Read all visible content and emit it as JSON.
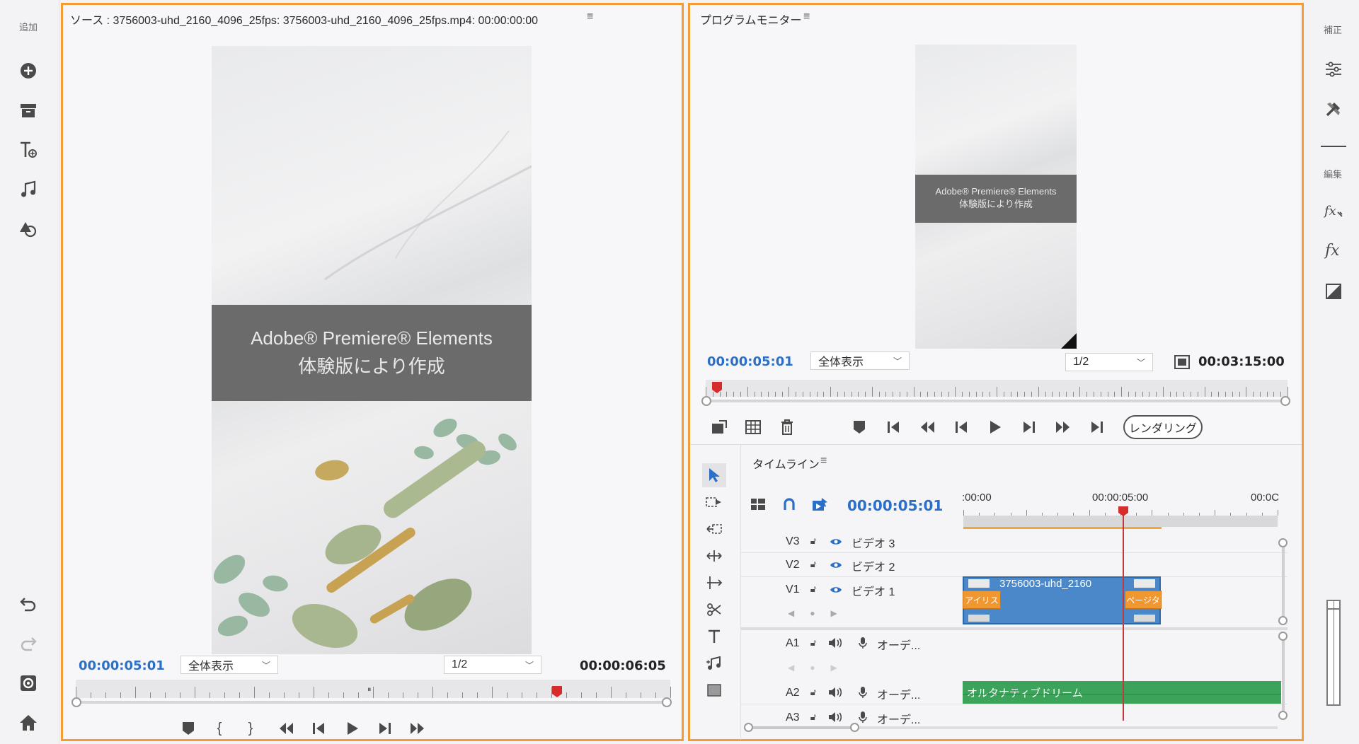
{
  "left_toolbar": {
    "label": "追加",
    "tools": [
      {
        "name": "add-media-icon"
      },
      {
        "name": "project-assets-icon"
      },
      {
        "name": "titles-icon"
      },
      {
        "name": "audio-icon"
      },
      {
        "name": "graphics-icon"
      }
    ],
    "bottom_tools": [
      {
        "name": "undo-icon"
      },
      {
        "name": "redo-icon"
      },
      {
        "name": "organizer-icon"
      },
      {
        "name": "home-icon"
      }
    ]
  },
  "right_toolbar": {
    "label_adjust": "補正",
    "label_edit": "編集"
  },
  "source": {
    "title": "ソース : 3756003-uhd_2160_4096_25fps: 3756003-uhd_2160_4096_25fps.mp4: 00:00:00:00",
    "watermark_line1": "Adobe® Premiere® Elements",
    "watermark_line2": "体験版により作成",
    "current_tc": "00:00:05:01",
    "zoom": "全体表示",
    "resolution": "1/2",
    "duration": "00:00:06:05",
    "playhead_fraction": 0.81
  },
  "program": {
    "title": "プログラムモニター",
    "watermark_line1": "Adobe® Premiere® Elements",
    "watermark_line2": "体験版により作成",
    "current_tc": "00:00:05:01",
    "zoom": "全体表示",
    "resolution": "1/2",
    "duration": "00:03:15:00",
    "render_label": "レンダリング"
  },
  "timeline": {
    "title": "タイムライン",
    "current_tc": "00:00:05:01",
    "ruler_labels": [
      ":00:00",
      "00:00:05:00",
      "00:0C"
    ],
    "tracks": [
      {
        "id": "V3",
        "name": "ビデオ 3"
      },
      {
        "id": "V2",
        "name": "ビデオ 2"
      },
      {
        "id": "V1",
        "name": "ビデオ 1"
      },
      {
        "id": "A1",
        "name": "オーデ..."
      },
      {
        "id": "A2",
        "name": "オーデ..."
      },
      {
        "id": "A3",
        "name": "オーデ..."
      }
    ],
    "video_clip_label": "3756003-uhd_2160",
    "transition_left": "アイリス",
    "transition_right": "ページタ",
    "audio_clip_label": "オルタナティブドリーム"
  },
  "colors": {
    "accent_orange": "#f39c34",
    "timecode_blue": "#2b6fc7",
    "clip_blue": "#4a88c9",
    "clip_green": "#3ba35a",
    "playhead_red": "#d62c2c"
  }
}
